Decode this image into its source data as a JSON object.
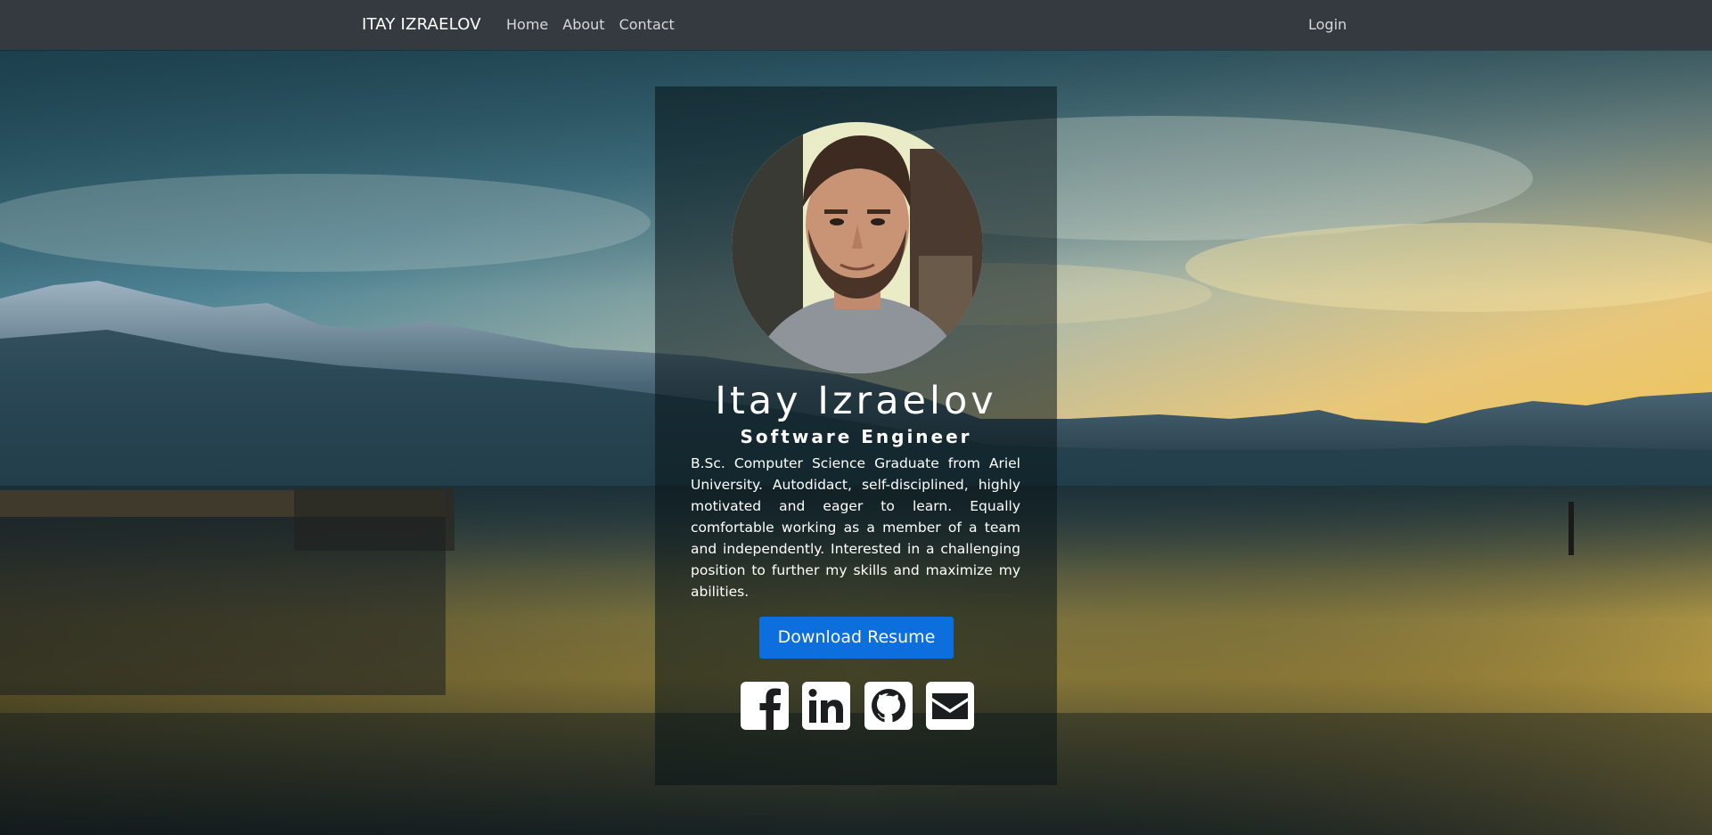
{
  "navbar": {
    "brand": "ITAY IZRAELOV",
    "links": [
      {
        "label": "Home"
      },
      {
        "label": "About"
      },
      {
        "label": "Contact"
      }
    ],
    "login": "Login",
    "background_color": "#343a40"
  },
  "profile": {
    "name": "Itay Izraelov",
    "title": "Software Engineer",
    "bio": "B.Sc. Computer Science Graduate from Ariel University. Autodidact, self-disciplined, highly motivated and eager to learn. Equally comfortable working as a member of a team and independently. Interested in a challenging position to further my skills and maximize my abilities.",
    "download_button": "Download Resume",
    "button_color": "#0d6ede"
  },
  "social_icons": [
    {
      "icon": "facebook-icon"
    },
    {
      "icon": "linkedin-icon"
    },
    {
      "icon": "github-icon"
    },
    {
      "icon": "envelope-icon"
    }
  ]
}
